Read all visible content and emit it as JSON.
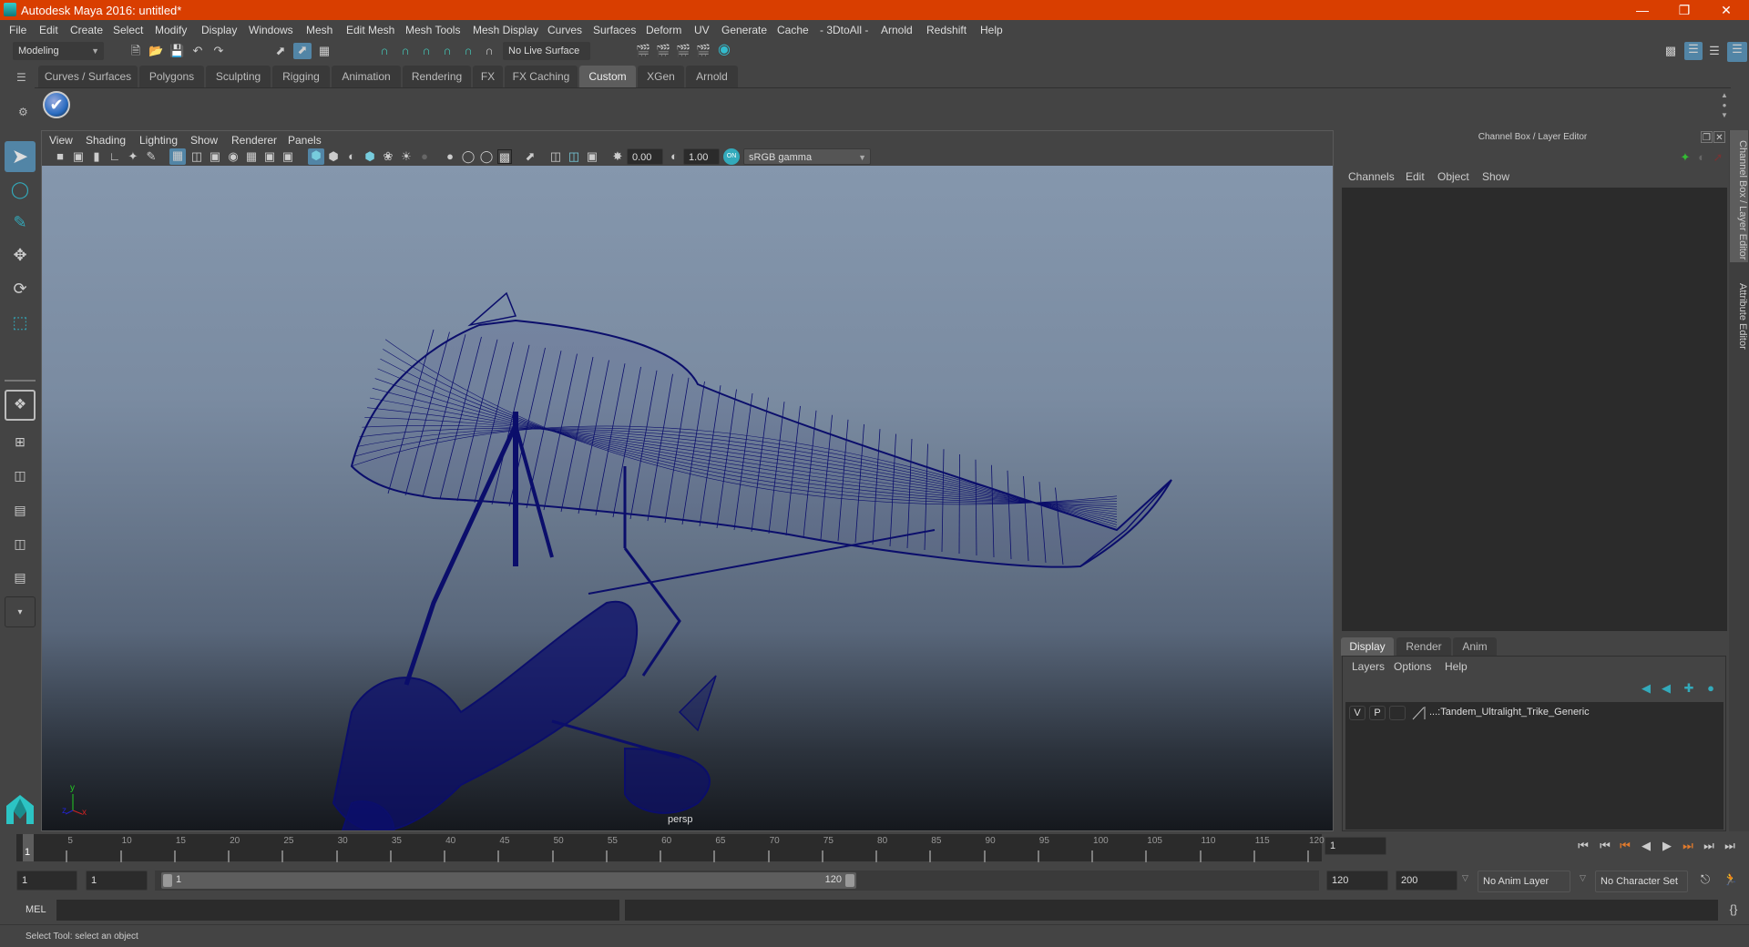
{
  "window": {
    "title": "Autodesk Maya 2016: untitled*",
    "controls": [
      "minimize",
      "restore",
      "close"
    ]
  },
  "menubar": [
    "File",
    "Edit",
    "Create",
    "Select",
    "Modify",
    "Display",
    "Windows",
    "Mesh",
    "Edit Mesh",
    "Mesh Tools",
    "Mesh Display",
    "Curves",
    "Surfaces",
    "Deform",
    "UV",
    "Generate",
    "Cache",
    "- 3DtoAll -",
    "Arnold",
    "Redshift",
    "Help"
  ],
  "statusline": {
    "menuset": "Modeling",
    "live_surface": "No Live Surface"
  },
  "shelf": {
    "tabs": [
      "Curves / Surfaces",
      "Polygons",
      "Sculpting",
      "Rigging",
      "Animation",
      "Rendering",
      "FX",
      "FX Caching",
      "Custom",
      "XGen",
      "Arnold"
    ],
    "active_tab": "Custom"
  },
  "viewport": {
    "menu": [
      "View",
      "Shading",
      "Lighting",
      "Show",
      "Renderer",
      "Panels"
    ],
    "near_value": "0.00",
    "far_value": "1.00",
    "color_space": "sRGB gamma",
    "camera_label": "persp",
    "axis": {
      "x": "x",
      "y": "y",
      "z": "z"
    },
    "wireframe_color": "#0b0e6b"
  },
  "channel_box": {
    "title": "Channel Box / Layer Editor",
    "menu": [
      "Channels",
      "Edit",
      "Object",
      "Show"
    ]
  },
  "layer_editor": {
    "tabs": [
      "Display",
      "Render",
      "Anim"
    ],
    "active_tab": "Display",
    "menu": [
      "Layers",
      "Options",
      "Help"
    ],
    "layers": [
      {
        "v": "V",
        "p": "P",
        "name": "...:Tandem_Ultralight_Trike_Generic"
      }
    ]
  },
  "side_tabs": [
    "Channel Box / Layer Editor",
    "Attribute Editor"
  ],
  "timeline": {
    "ticks": [
      5,
      10,
      15,
      20,
      25,
      30,
      35,
      40,
      45,
      50,
      55,
      60,
      65,
      70,
      75,
      80,
      85,
      90,
      95,
      100,
      105,
      110,
      115,
      120
    ],
    "current_frame_marker": "1",
    "current_frame": "1"
  },
  "range": {
    "start": "1",
    "anim_start": "1",
    "slider_start": "1",
    "slider_end": "120",
    "anim_end": "120",
    "end": "200",
    "anim_layer": "No Anim Layer",
    "character_set": "No Character Set"
  },
  "command_line": {
    "label": "MEL",
    "value": ""
  },
  "help_line": "Select Tool: select an object",
  "colors": {
    "title_bar": "#d93e00",
    "accent": "#5285a6",
    "key_orange": "#e07a2c"
  }
}
